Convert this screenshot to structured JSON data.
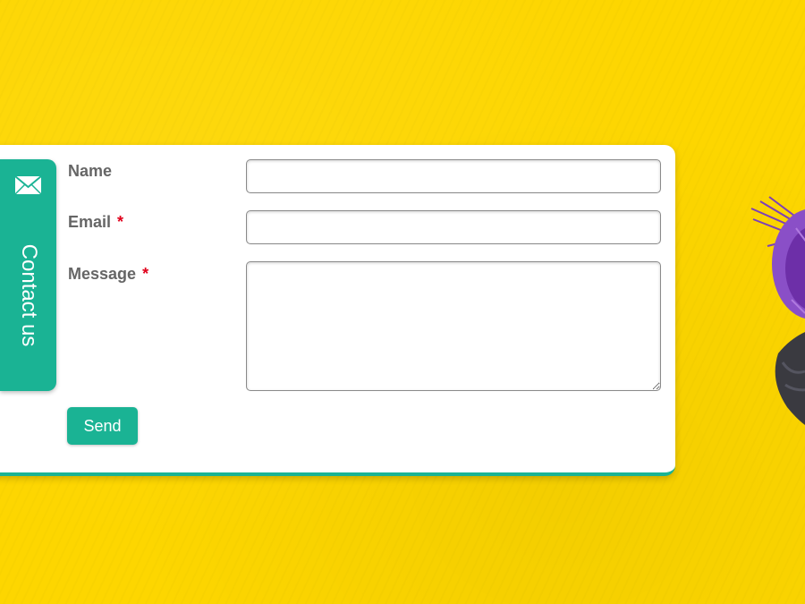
{
  "tab": {
    "label": "Contact us",
    "icon": "mail-icon"
  },
  "form": {
    "name_label": "Name",
    "email_label": "Email",
    "message_label": "Message",
    "required_mark": "*",
    "name_value": "",
    "email_value": "",
    "message_value": "",
    "send_label": "Send"
  },
  "colors": {
    "background": "#fdd600",
    "accent": "#1ab394",
    "required": "#e0001b",
    "label": "#666666"
  }
}
